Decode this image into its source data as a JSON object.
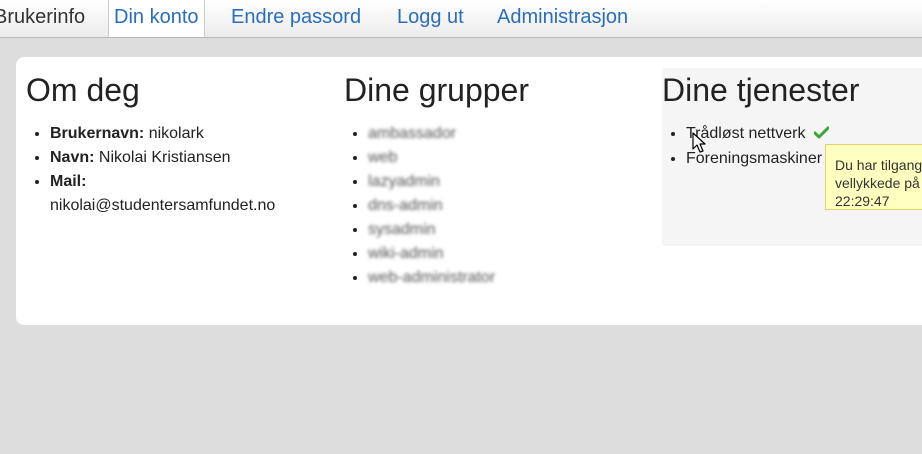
{
  "nav": {
    "brand": "Brukerinfo",
    "items": [
      "Din konto",
      "Endre passord",
      "Logg ut",
      "Administrasjon"
    ]
  },
  "about": {
    "title": "Om deg",
    "username_label": "Brukernavn:",
    "username": "nikolark",
    "name_label": "Navn:",
    "name": "Nikolai Kristiansen",
    "mail_label": "Mail:",
    "mail": "nikolai@studentersamfundet.no"
  },
  "groups": {
    "title": "Dine grupper",
    "items": [
      "ambassador",
      "web",
      "lazyadmin",
      "dns-admin",
      "sysadmin",
      "wiki-admin",
      "web-administrator"
    ]
  },
  "services": {
    "title": "Dine tjenester",
    "items": [
      "Trådløst nettverk",
      "Foreningsmaskiner"
    ]
  },
  "tooltip": {
    "line1": "Du har tilgang",
    "line2": "vellykkede på",
    "line3": "22:29:47"
  },
  "colors": {
    "link": "#2a6ebb",
    "check": "#3aa63a",
    "tooltip_bg": "#ffffc0"
  }
}
